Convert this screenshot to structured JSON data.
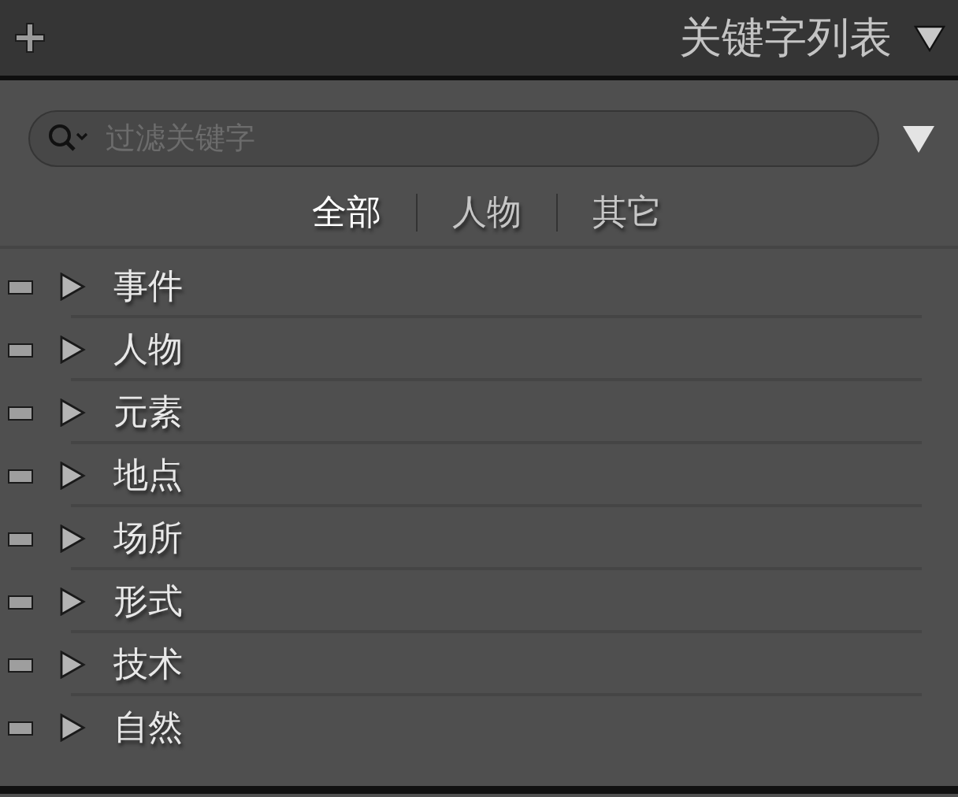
{
  "header": {
    "title": "关键字列表"
  },
  "search": {
    "placeholder": "过滤关键字"
  },
  "tabs": [
    {
      "label": "全部",
      "selected": true
    },
    {
      "label": "人物",
      "selected": false
    },
    {
      "label": "其它",
      "selected": false
    }
  ],
  "keywords": [
    {
      "label": "事件",
      "expanded": false
    },
    {
      "label": "人物",
      "expanded": false
    },
    {
      "label": "元素",
      "expanded": false
    },
    {
      "label": "地点",
      "expanded": false
    },
    {
      "label": "场所",
      "expanded": false
    },
    {
      "label": "形式",
      "expanded": false
    },
    {
      "label": "技术",
      "expanded": false
    },
    {
      "label": "自然",
      "expanded": false
    }
  ]
}
